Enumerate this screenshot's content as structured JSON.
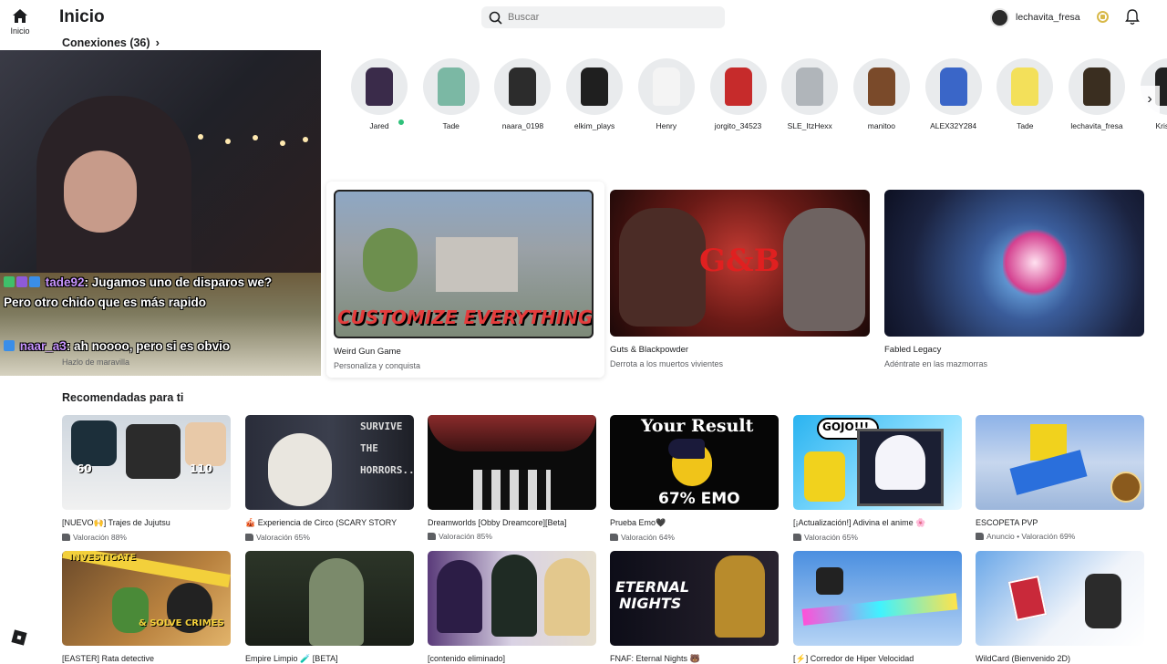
{
  "nav": {
    "home_label": "Inicio"
  },
  "header": {
    "title": "Inicio",
    "search_placeholder": "Buscar",
    "username": "lechavita_fresa"
  },
  "connections": {
    "title": "Conexiones (36)",
    "friends": [
      {
        "name": "Jared",
        "online": true
      },
      {
        "name": "Tade",
        "online": false
      },
      {
        "name": "naara_0198",
        "online": false
      },
      {
        "name": "elkim_plays",
        "online": false
      },
      {
        "name": "Henry",
        "online": false
      },
      {
        "name": "jorgito_34523",
        "online": false
      },
      {
        "name": "SLE_ItzHexx",
        "online": false
      },
      {
        "name": "manitoo",
        "online": false
      },
      {
        "name": "ALEX32Y284",
        "online": false
      },
      {
        "name": "Tade",
        "online": false
      },
      {
        "name": "lechavita_fresa",
        "online": false
      },
      {
        "name": "Krisbla:",
        "online": false
      }
    ]
  },
  "stream_overlay": {
    "messages": [
      {
        "user": "tade92",
        "text": ": Jugamos uno de disparos we? Pero otro chido que es más rapido"
      },
      {
        "user": "naar_a3",
        "text": ": ah noooo, pero si es obvio"
      }
    ]
  },
  "featured": [
    {
      "title": "Hazlo de maravilla",
      "subtitle": ""
    },
    {
      "title": "Weird Gun Game",
      "subtitle": "Personaliza y conquista",
      "thumb_text": "CUSTOMIZE EVERYTHING"
    },
    {
      "title": "Guts & Blackpowder",
      "subtitle": "Derrota a los muertos vivientes",
      "thumb_text": "G&B"
    },
    {
      "title": "Fabled Legacy",
      "subtitle": "Adéntrate en las mazmorras"
    }
  ],
  "recommended": {
    "title": "Recomendadas para ti",
    "row1": [
      {
        "name": "[NUEVO🙌] Trajes de Jujutsu",
        "rating": "Valoración 88%",
        "thumb_a": "60",
        "thumb_b": "110"
      },
      {
        "name": "🎪 Experiencia de Circo (SCARY STORY",
        "rating": "Valoración 65%",
        "thumb_a": "SURVIVE",
        "thumb_b": "THE",
        "thumb_c": "HORRORS..."
      },
      {
        "name": "Dreamworlds [Obby Dreamcore][Beta]",
        "rating": "Valoración 85%"
      },
      {
        "name": "Prueba Emo🖤",
        "rating": "Valoración 64%",
        "thumb_a": "Your Result",
        "thumb_b": "67% EMO"
      },
      {
        "name": "[¡Actualización!] Adivina el anime 🌸",
        "rating": "Valoración 65%",
        "thumb_a": "GOJO!!!"
      },
      {
        "name": "ESCOPETA PVP",
        "rating": "Anuncio • Valoración 69%"
      }
    ],
    "row2": [
      {
        "name": "[EASTER] Rata detective",
        "thumb_a": "INVESTIGATE",
        "thumb_b": "& SOLVE CRIMES"
      },
      {
        "name": "Empire Limpio 🧪 [BETA]"
      },
      {
        "name": "[contenido eliminado]"
      },
      {
        "name": "FNAF: Eternal Nights 🐻",
        "thumb_a": "ETERNAL",
        "thumb_b": "NIGHTS"
      },
      {
        "name": "[⚡] Corredor de Hiper Velocidad"
      },
      {
        "name": "WildCard (Bienvenido 2D)"
      }
    ]
  }
}
